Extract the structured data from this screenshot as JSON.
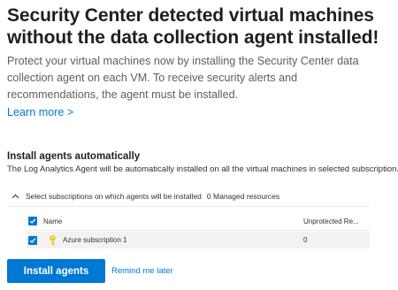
{
  "header": {
    "title": "Security Center detected virtual machines without the data collection agent installed!",
    "description": "Protect your virtual machines now by installing the Security Center data collection agent on each VM. To receive security alerts and recommendations, the agent must be installed.",
    "learn_more": "Learn more >"
  },
  "install_section": {
    "title": "Install agents automatically",
    "description": "The Log Analytics Agent will be automatically installed on all the virtual machines in selected subscription."
  },
  "subscriptions_panel": {
    "header_label": "Select subscriptions on which agents will be installed",
    "managed_count": "0 Managed resources",
    "columns": [
      "Name",
      "Unprotected Re..."
    ],
    "rows": [
      {
        "name": "Azure subscription 1",
        "unprotected": "0",
        "checked": true
      }
    ]
  },
  "footer": {
    "install_button": "Install agents",
    "remind_link": "Remind me later"
  },
  "colors": {
    "accent": "#0078d4",
    "subscription_key_icon": "#f2c811"
  },
  "icons": [
    "chevron-up-icon",
    "checkmark-icon",
    "key-icon"
  ]
}
